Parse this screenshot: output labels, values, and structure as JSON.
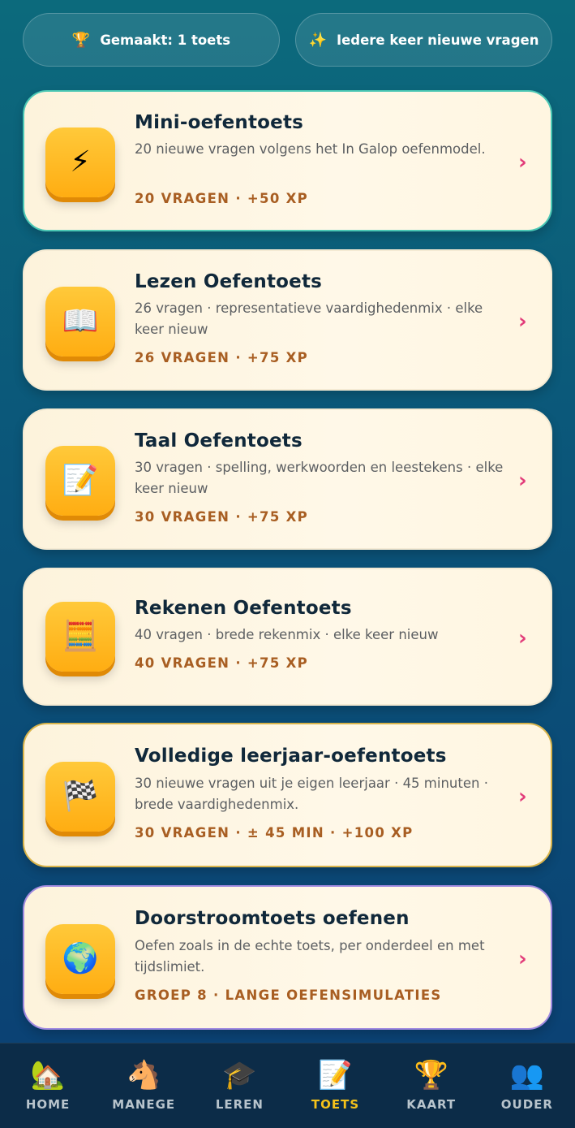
{
  "top_pills": [
    {
      "icon": "trophy-icon",
      "emoji": "🏆",
      "label": "Gemaakt: 1 toets"
    },
    {
      "icon": "sparkles-icon",
      "emoji": "✨",
      "label": "Iedere keer nieuwe vragen"
    }
  ],
  "tests": [
    {
      "icon": "lightning-icon",
      "emoji": "⚡",
      "title": "Mini-oefentoets",
      "desc": "20 nieuwe vragen volgens het In Galop oefenmodel.",
      "meta": "20 VRAGEN · +50 XP",
      "border": "#4bc7b4"
    },
    {
      "icon": "book-icon",
      "emoji": "📖",
      "title": "Lezen Oefentoets",
      "desc": "26 vragen · representatieve vaardighedenmix · elke keer nieuw",
      "meta": "26 VRAGEN · +75 XP"
    },
    {
      "icon": "writing-icon",
      "emoji": "📝",
      "title": "Taal Oefentoets",
      "desc": "30 vragen · spelling, werkwoorden en leestekens · elke keer nieuw",
      "meta": "30 VRAGEN · +75 XP"
    },
    {
      "icon": "calculator-icon",
      "emoji": "🧮",
      "title": "Rekenen Oefentoets",
      "desc": "40 vragen · brede rekenmix · elke keer nieuw",
      "meta": "40 VRAGEN · +75 XP"
    },
    {
      "icon": "checkered-flag-icon",
      "emoji": "🏁",
      "title": "Volledige leerjaar-oefentoets",
      "desc": "30 nieuwe vragen uit je eigen leerjaar · 45 minuten · brede vaardighedenmix.",
      "meta": "30 VRAGEN · ± 45 MIN · +100 XP",
      "border": "#d9b44a"
    },
    {
      "icon": "globe-magnifier-icon",
      "emoji": "🌍",
      "title": "Doorstroomtoets oefenen",
      "desc": "Oefen zoals in de echte toets, per onderdeel en met tijdslimiet.",
      "meta": "GROEP 8 · LANGE OEFENSIMULATIES",
      "border": "#a08ae0"
    }
  ],
  "nav": [
    {
      "icon": "house-icon",
      "emoji": "🏡",
      "label": "HOME",
      "active": false
    },
    {
      "icon": "horse-icon",
      "emoji": "🐴",
      "label": "MANEGE",
      "active": false
    },
    {
      "icon": "graduation-cap-icon",
      "emoji": "🎓",
      "label": "LEREN",
      "active": false
    },
    {
      "icon": "memo-icon",
      "emoji": "📝",
      "label": "TOETS",
      "active": true
    },
    {
      "icon": "trophy-icon",
      "emoji": "🏆",
      "label": "KAART",
      "active": false
    },
    {
      "icon": "family-icon",
      "emoji": "👥",
      "label": "OUDER",
      "active": false
    }
  ],
  "colors": {
    "accent_active": "#f5c21a",
    "chevron": "#e23c7a",
    "meta_text": "#a85e22"
  }
}
